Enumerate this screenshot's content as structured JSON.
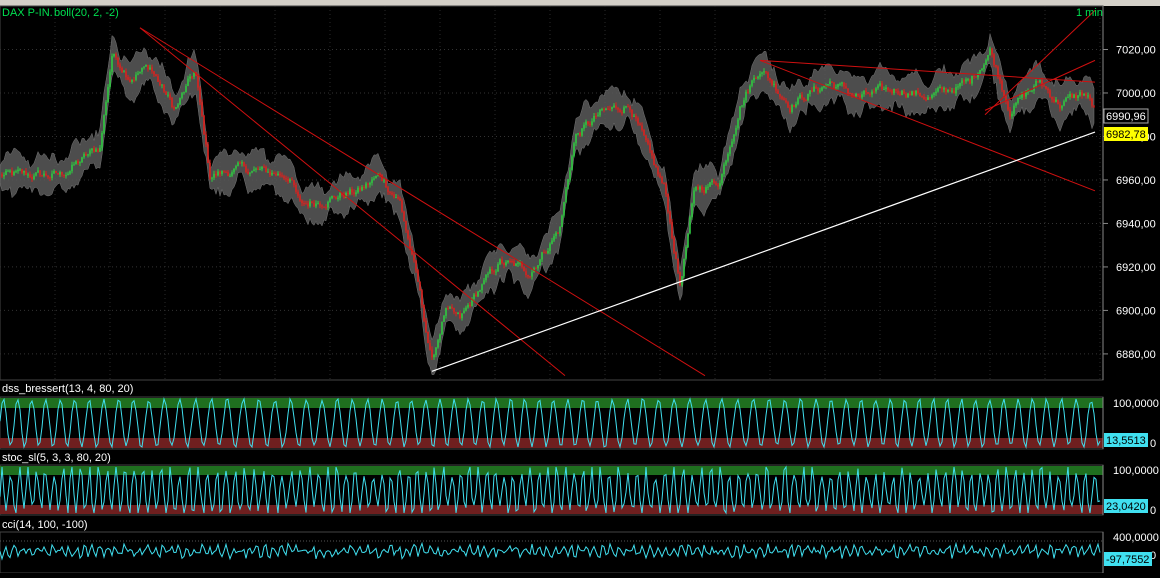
{
  "main": {
    "title": "DAX P-IN.",
    "indicator": "boll(20, 2, -2)",
    "timeframe": "1 min",
    "price_label_upper": "6990,96",
    "price_label_last": "6982,78",
    "y_ticks": [
      "7020,00",
      "7000,00",
      "6980,00",
      "6960,00",
      "6940,00",
      "6920,00",
      "6900,00",
      "6880,00"
    ]
  },
  "panels": [
    {
      "title": "dss_bressert(13, 4, 80, 20)",
      "tick_top": "100,0000",
      "tick_bottom": "0",
      "value_label": "13,5513"
    },
    {
      "title": "stoc_sl(5, 3, 3, 80, 20)",
      "tick_top": "100,0000",
      "tick_bottom": "0",
      "value_label": "23,0420"
    },
    {
      "title": "cci(14, 100, -100)",
      "tick_top": "400,0000",
      "tick_bottom": "0",
      "value_label": "-97,7552"
    }
  ],
  "colors": {
    "background": "#000000",
    "up_candle": "#2ecc40",
    "down_candle": "#e0201c",
    "band_fill": "#5a5a5a",
    "trend_red": "#d01010",
    "trend_white": "#ffffff",
    "oscillator": "#40e0f0",
    "overbought_zone": "#1f6f1f",
    "oversold_zone": "#6f1f1f",
    "last_price_bg": "#ffff00",
    "title_text": "#00e050"
  },
  "chart_data": [
    {
      "type": "candlestick",
      "title": "DAX P-IN.",
      "ylim": [
        6868,
        7040
      ],
      "price_path": [
        [
          0,
          6962
        ],
        [
          60,
          6962
        ],
        [
          100,
          6975
        ],
        [
          112,
          7018
        ],
        [
          130,
          7008
        ],
        [
          150,
          7012
        ],
        [
          175,
          6992
        ],
        [
          195,
          7010
        ],
        [
          210,
          6962
        ],
        [
          240,
          6965
        ],
        [
          290,
          6962
        ],
        [
          300,
          6948
        ],
        [
          330,
          6952
        ],
        [
          360,
          6955
        ],
        [
          380,
          6962
        ],
        [
          400,
          6950
        ],
        [
          418,
          6912
        ],
        [
          432,
          6876
        ],
        [
          445,
          6900
        ],
        [
          460,
          6895
        ],
        [
          480,
          6910
        ],
        [
          500,
          6922
        ],
        [
          530,
          6918
        ],
        [
          560,
          6938
        ],
        [
          575,
          6980
        ],
        [
          600,
          6990
        ],
        [
          630,
          6995
        ],
        [
          650,
          6970
        ],
        [
          665,
          6955
        ],
        [
          680,
          6912
        ],
        [
          695,
          6955
        ],
        [
          720,
          6960
        ],
        [
          740,
          6995
        ],
        [
          760,
          7012
        ],
        [
          790,
          6995
        ],
        [
          830,
          7005
        ],
        [
          860,
          6998
        ],
        [
          900,
          7002
        ],
        [
          930,
          6998
        ],
        [
          970,
          7005
        ],
        [
          990,
          7020
        ],
        [
          1010,
          6993
        ],
        [
          1040,
          7005
        ],
        [
          1060,
          6995
        ],
        [
          1085,
          7000
        ],
        [
          1095,
          6992
        ]
      ],
      "trendlines": [
        {
          "color": "red",
          "from": [
            140,
            7030
          ],
          "to": [
            565,
            6870
          ]
        },
        {
          "color": "red",
          "from": [
            140,
            7030
          ],
          "to": [
            705,
            6870
          ]
        },
        {
          "color": "red",
          "from": [
            760,
            7015
          ],
          "to": [
            1095,
            6955
          ]
        },
        {
          "color": "red",
          "from": [
            760,
            7015
          ],
          "to": [
            1095,
            7005
          ]
        },
        {
          "color": "red",
          "from": [
            985,
            6990
          ],
          "to": [
            1095,
            7038
          ]
        },
        {
          "color": "red",
          "from": [
            985,
            6992
          ],
          "to": [
            1095,
            7015
          ]
        },
        {
          "color": "white",
          "from": [
            432,
            6872
          ],
          "to": [
            1095,
            6982
          ]
        }
      ]
    },
    {
      "type": "line",
      "title": "dss_bressert(13, 4, 80, 20)",
      "ylim": [
        0,
        100
      ],
      "last_value": 13.5513
    },
    {
      "type": "line",
      "title": "stoc_sl(5, 3, 3, 80, 20)",
      "ylim": [
        0,
        100
      ],
      "last_value": 23.042
    },
    {
      "type": "line",
      "title": "cci(14, 100, -100)",
      "ylim": [
        -400,
        400
      ],
      "last_value": -97.7552
    }
  ]
}
